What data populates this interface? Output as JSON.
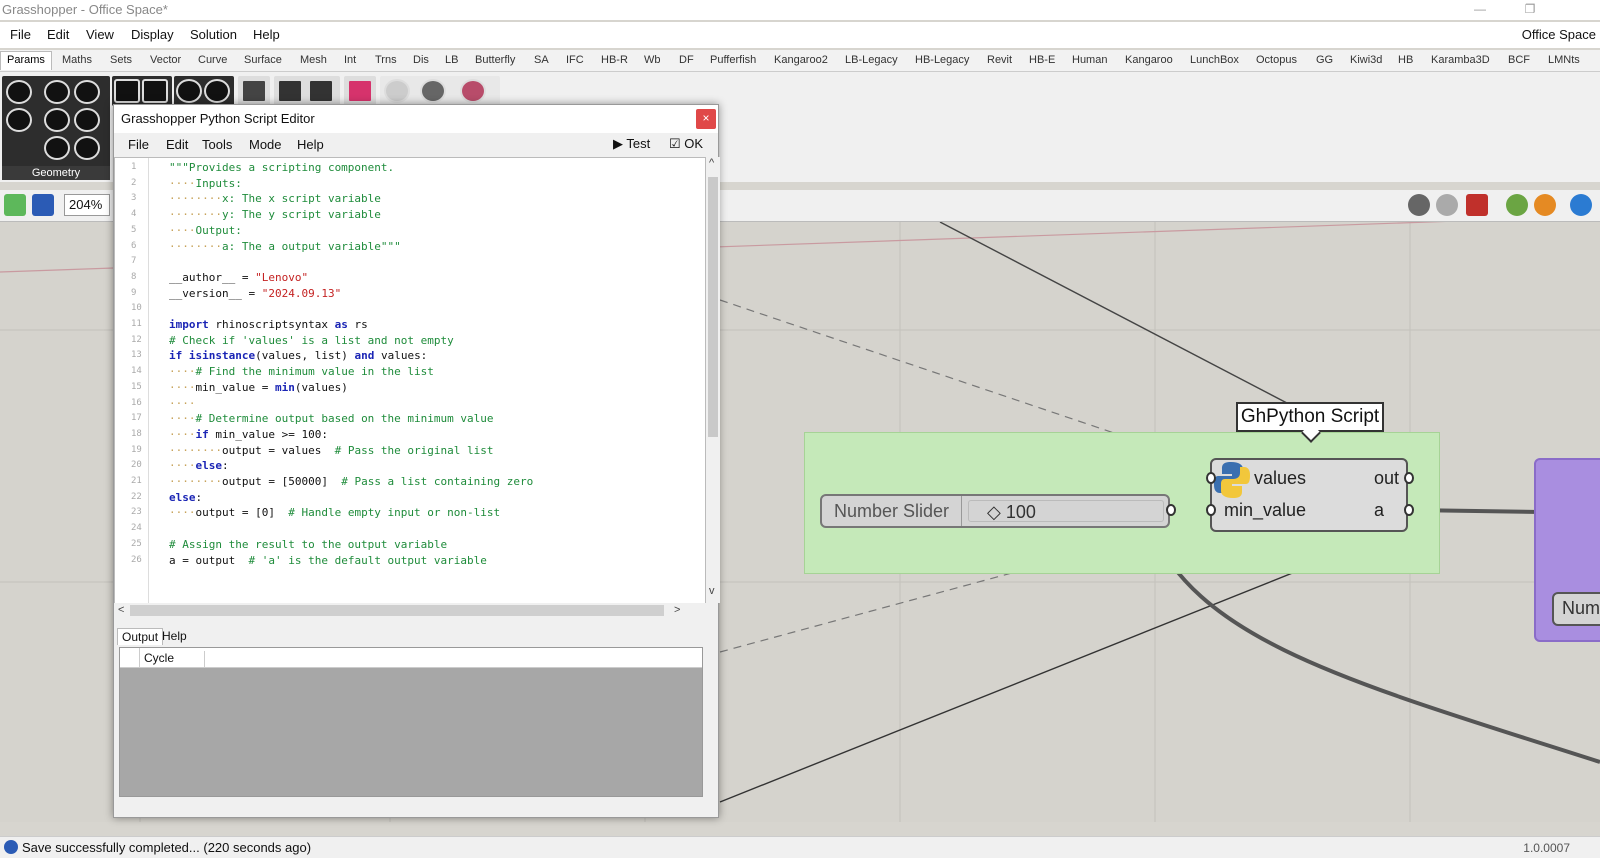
{
  "window": {
    "title": "Grasshopper - Office Space*",
    "minimize": "—",
    "restore": "❐"
  },
  "menubar": {
    "items": [
      "File",
      "Edit",
      "View",
      "Display",
      "Solution",
      "Help"
    ],
    "document": "Office Space"
  },
  "tabs": [
    "Params",
    "Maths",
    "Sets",
    "Vector",
    "Curve",
    "Surface",
    "Mesh",
    "Int",
    "Trns",
    "Dis",
    "LB",
    "Butterfly",
    "SA",
    "IFC",
    "HB-R",
    "Wb",
    "DF",
    "Pufferfish",
    "Kangaroo2",
    "LB-Legacy",
    "HB-Legacy",
    "Revit",
    "HB-E",
    "Human",
    "Kangaroo",
    "LunchBox",
    "Octopus",
    "GG",
    "Kiwi3d",
    "HB",
    "Karamba3D",
    "BCF",
    "LMNts"
  ],
  "ribbon": {
    "group_label": "Geometry"
  },
  "canvas_toolbar": {
    "zoom": "204%"
  },
  "editor": {
    "title": "Grasshopper Python Script Editor",
    "close": "×",
    "menu": [
      "File",
      "Edit",
      "Tools",
      "Mode",
      "Help"
    ],
    "test_label": "▶ Test",
    "ok_label": "☑ OK",
    "scroll_up": "^",
    "scroll_down": "v",
    "scroll_left": "<",
    "scroll_right": ">",
    "lines": [
      [
        [
          "c-cm",
          "\"\"\"Provides a scripting component."
        ]
      ],
      [
        [
          "c-ws",
          "····"
        ],
        [
          "c-cm",
          "Inputs:"
        ]
      ],
      [
        [
          "c-ws",
          "········"
        ],
        [
          "c-cm",
          "x: The x script variable"
        ]
      ],
      [
        [
          "c-ws",
          "········"
        ],
        [
          "c-cm",
          "y: The y script variable"
        ]
      ],
      [
        [
          "c-ws",
          "····"
        ],
        [
          "c-cm",
          "Output:"
        ]
      ],
      [
        [
          "c-ws",
          "········"
        ],
        [
          "c-cm",
          "a: The a output variable\"\"\""
        ]
      ],
      [],
      [
        [
          "",
          "__author__ = "
        ],
        [
          "c-st",
          "\"Lenovo\""
        ]
      ],
      [
        [
          "",
          "__version__ = "
        ],
        [
          "c-st",
          "\"2024.09.13\""
        ]
      ],
      [],
      [
        [
          "c-kw",
          "import"
        ],
        [
          "",
          " rhinoscriptsyntax "
        ],
        [
          "c-kw",
          "as"
        ],
        [
          "",
          " rs"
        ]
      ],
      [
        [
          "c-cm",
          "# Check if 'values' is a list and not empty"
        ]
      ],
      [
        [
          "c-kw",
          "if"
        ],
        [
          "",
          " "
        ],
        [
          "c-kw",
          "isinstance"
        ],
        [
          "",
          "(values, list) "
        ],
        [
          "c-kw",
          "and"
        ],
        [
          "",
          " values:"
        ]
      ],
      [
        [
          "c-ws",
          "····"
        ],
        [
          "c-cm",
          "# Find the minimum value in the list"
        ]
      ],
      [
        [
          "c-ws",
          "····"
        ],
        [
          "",
          "min_value = "
        ],
        [
          "c-kw",
          "min"
        ],
        [
          "",
          "(values)"
        ]
      ],
      [
        [
          "c-ws",
          "····"
        ]
      ],
      [
        [
          "c-ws",
          "····"
        ],
        [
          "c-cm",
          "# Determine output based on the minimum value"
        ]
      ],
      [
        [
          "c-ws",
          "····"
        ],
        [
          "c-kw",
          "if"
        ],
        [
          "",
          " min_value >= 100:"
        ]
      ],
      [
        [
          "c-ws",
          "········"
        ],
        [
          "",
          "output = values  "
        ],
        [
          "c-cm",
          "# Pass the original list"
        ]
      ],
      [
        [
          "c-ws",
          "····"
        ],
        [
          "c-kw",
          "else"
        ],
        [
          "",
          ":"
        ]
      ],
      [
        [
          "c-ws",
          "········"
        ],
        [
          "",
          "output = [50000]  "
        ],
        [
          "c-cm",
          "# Pass a list containing zero"
        ]
      ],
      [
        [
          "c-kw",
          "else"
        ],
        [
          "",
          ":"
        ]
      ],
      [
        [
          "c-ws",
          "····"
        ],
        [
          "",
          "output = [0]  "
        ],
        [
          "c-cm",
          "# Handle empty input or non-list"
        ]
      ],
      [],
      [
        [
          "c-cm",
          "# Assign the result to the output variable"
        ]
      ],
      [
        [
          "",
          "a = output  "
        ],
        [
          "c-cm",
          "# 'a' is the default output variable"
        ]
      ]
    ],
    "output_tabs": [
      "Output",
      "Help"
    ],
    "output_column": "Cycle"
  },
  "canvas": {
    "tooltip": "GhPython Script",
    "slider": {
      "name": "Number Slider",
      "value": "◇ 100"
    },
    "component": {
      "inputs": [
        "values",
        "min_value"
      ],
      "outputs": [
        "out",
        "a"
      ],
      "icon": "python-logo-icon"
    },
    "num_stub": "Num"
  },
  "status": {
    "message": "Save successfully completed... (220 seconds ago)",
    "version": "1.0.0007"
  }
}
